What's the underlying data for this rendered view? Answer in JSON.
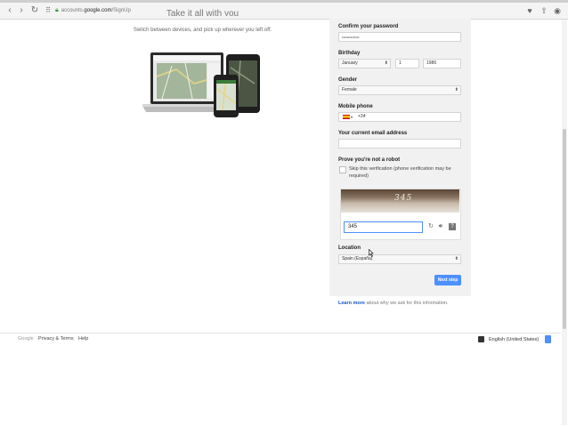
{
  "browser": {
    "url_host": "accounts.",
    "url_domain": "google.com",
    "url_path": "/SignUp"
  },
  "promo": {
    "tagline": "Take it all with you",
    "subline": "Switch between devices, and pick up wherever you left off."
  },
  "form": {
    "confirm_password_label": "Confirm your password",
    "confirm_password_value": "••••••••••••••",
    "birthday_label": "Birthday",
    "birthday_month": "January",
    "birthday_day": "1",
    "birthday_year": "1986",
    "gender_label": "Gender",
    "gender_value": "Female",
    "phone_label": "Mobile phone",
    "phone_code": "+34",
    "email_label": "Your current email address",
    "email_value": "",
    "robot_label": "Prove you're not a robot",
    "skip_text": "Skip this verification (phone verification may be required)",
    "captcha_image_text": "345",
    "captcha_input": "345",
    "location_label": "Location",
    "location_value": "Spain (España)",
    "next_label": "Next step"
  },
  "learn": {
    "link": "Learn more",
    "rest": " about why we ask for this information."
  },
  "footer": {
    "google": "Google",
    "privacy": "Privacy & Terms",
    "help": "Help",
    "language": "English (United States)"
  },
  "colors": {
    "accent": "#4d90fe",
    "panel": "#f1f1f1",
    "link": "#1155cc"
  }
}
